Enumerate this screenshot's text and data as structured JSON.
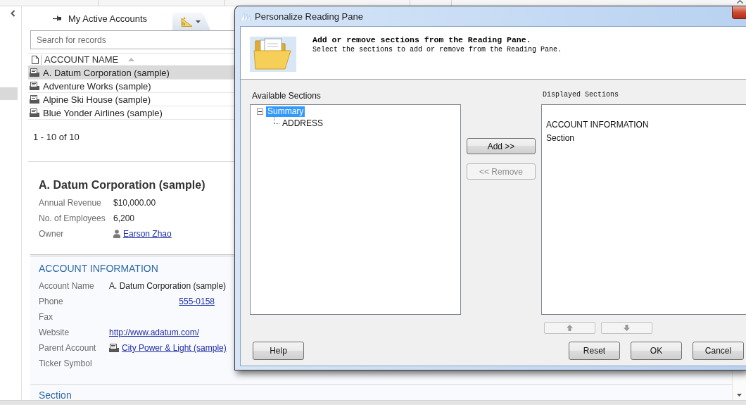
{
  "list_pane": {
    "view_title": "My Active Accounts",
    "search": {
      "placeholder": "Search for records"
    },
    "table": {
      "columns": [
        {
          "label": "ACCOUNT NAME",
          "sorted": true
        }
      ],
      "rows": [
        {
          "name": "A. Datum Corporation (sample)",
          "selected": true
        },
        {
          "name": "Adventure Works (sample)",
          "selected": false
        },
        {
          "name": "Alpine Ski House (sample)",
          "selected": false
        },
        {
          "name": "Blue Yonder Airlines (sample)",
          "selected": false
        }
      ]
    },
    "pager": "1 - 10 of 10"
  },
  "reading_pane": {
    "title": "A. Datum Corporation (sample)",
    "summary_fields": [
      {
        "label": "Annual Revenue",
        "kind": "text",
        "value": "$10,000.00"
      },
      {
        "label": "No. of Employees",
        "kind": "text",
        "value": "6,200"
      },
      {
        "label": "Owner",
        "kind": "user_link",
        "value": "Earson Zhao"
      }
    ],
    "sections": [
      {
        "heading": "ACCOUNT INFORMATION",
        "fields": [
          {
            "label": "Account Name",
            "kind": "text",
            "value": "A. Datum Corporation (sample)"
          },
          {
            "label": "Phone",
            "kind": "phone",
            "value": "555-0158"
          },
          {
            "label": "Fax",
            "kind": "text"
          },
          {
            "label": "Website",
            "kind": "link",
            "value": "http://www.adatum.com/"
          },
          {
            "label": "Parent Account",
            "kind": "record_link",
            "value": "City Power & Light (sample)"
          },
          {
            "label": "Ticker Symbol",
            "kind": "text"
          }
        ]
      },
      {
        "heading": "Section"
      }
    ]
  },
  "dialog": {
    "title": "Personalize Reading Pane",
    "heading": "Add or remove sections from the Reading Pane.",
    "instruction": "Select the sections to add or remove from the Reading Pane.",
    "available": {
      "label": "Available Sections",
      "tree": [
        {
          "label": "Summary",
          "selected": true,
          "expanded": true,
          "children": [
            {
              "label": "ADDRESS",
              "selected": false
            }
          ]
        }
      ]
    },
    "transfer_buttons": [
      {
        "label": "Add >>",
        "disabled": false
      },
      {
        "label": "<< Remove",
        "disabled": true
      }
    ],
    "displayed": {
      "label": "Displayed Sections",
      "items": [
        {
          "label": "ACCOUNT INFORMATION"
        },
        {
          "label": "Section"
        }
      ]
    },
    "order_buttons": [
      {
        "kind": "move_up",
        "disabled": true
      },
      {
        "kind": "move_down",
        "disabled": true
      }
    ],
    "help_button": {
      "label": "Help"
    },
    "buttons": [
      {
        "label": "Reset"
      },
      {
        "label": "OK"
      },
      {
        "label": "Cancel"
      }
    ]
  }
}
